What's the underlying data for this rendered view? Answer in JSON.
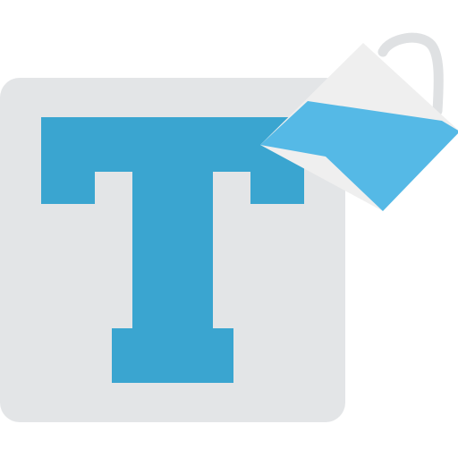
{
  "icon": {
    "name": "text-fill-color-icon",
    "colors": {
      "tile": "#e3e5e7",
      "glyph": "#3aa5d0",
      "pitcher_body": "#efefef",
      "pitcher_handle": "#dfe1e3",
      "liquid": "#55b9e6"
    }
  }
}
